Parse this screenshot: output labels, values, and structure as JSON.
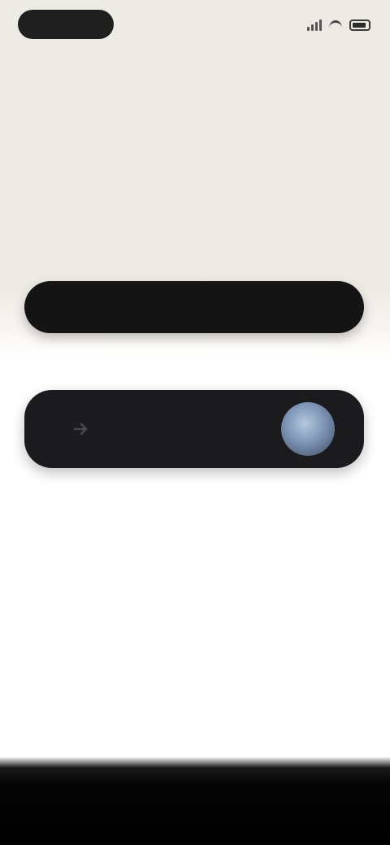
{
  "status_bar": {
    "pill_text": "",
    "icons": [
      "signal-icon",
      "wifi-icon",
      "battery-icon"
    ]
  },
  "location": {
    "title": "",
    "subtitle": ""
  },
  "status": {
    "time": "",
    "vehicle": ""
  },
  "primary_button": {
    "label": ""
  },
  "dock": {
    "label": "",
    "icon": "arrow-icon"
  },
  "info": {
    "title": "",
    "body": ""
  },
  "nav": {
    "items": [
      "",
      "",
      "",
      "",
      ""
    ]
  },
  "colors": {
    "hero_bg": "#eeebe4",
    "button_dark": "#141414",
    "avatar_blue": "#7c95b6"
  }
}
